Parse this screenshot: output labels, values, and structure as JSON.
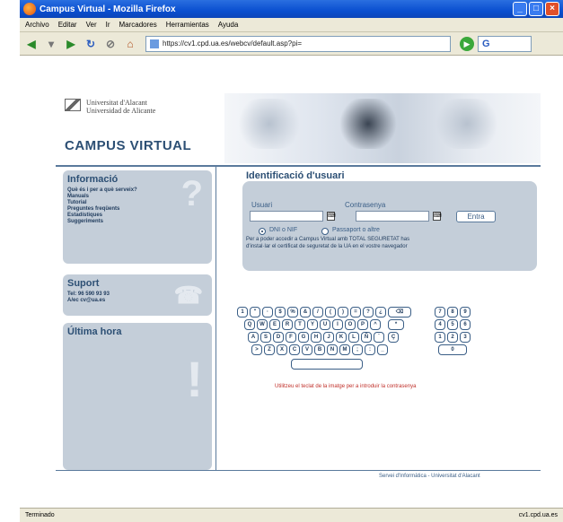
{
  "window": {
    "title": "Campus Virtual - Mozilla Firefox"
  },
  "menu": [
    "Archivo",
    "Editar",
    "Ver",
    "Ir",
    "Marcadores",
    "Herramientas",
    "Ayuda"
  ],
  "toolbar": {
    "url": "https://cv1.cpd.ua.es/webcv/default.asp?pi="
  },
  "page": {
    "university": [
      "Universitat d'Alacant",
      "Universidad de Alicante"
    ],
    "campus_title": "CAMPUS VIRTUAL",
    "informacio": {
      "title": "Informació",
      "links": [
        "Què és i per a què serveix?",
        "Manuals",
        "Tutorial",
        "Preguntes freqüents",
        "Estadístiques",
        "Suggeriments"
      ]
    },
    "suport": {
      "title": "Suport",
      "tel": "Tel: 96 590 93 93",
      "email": "A/ec cv@ua.es"
    },
    "ultima_hora": {
      "title": "Última hora"
    },
    "login": {
      "title": "Identificació d'usuari",
      "user_label": "Usuari",
      "password_label": "Contrasenya",
      "enter_label": "Entra",
      "radio_dni": "DNI o NIF",
      "radio_pass": "Passaport o altre",
      "note_1": "Per a poder accedir a Campus Virtual amb TOTAL SEGURETAT has",
      "note_2": "d'instal·lar el certificat de seguretat de la UA en el vostre navegador"
    },
    "keyboard_hint": "Utilitzeu el teclat de la imatge per a introduir la contrasenya",
    "footer": "Servei d'Informàtica - Universitat d'Alacant"
  },
  "status": {
    "left": "Terminado",
    "right": "cv1.cpd.ua.es"
  }
}
